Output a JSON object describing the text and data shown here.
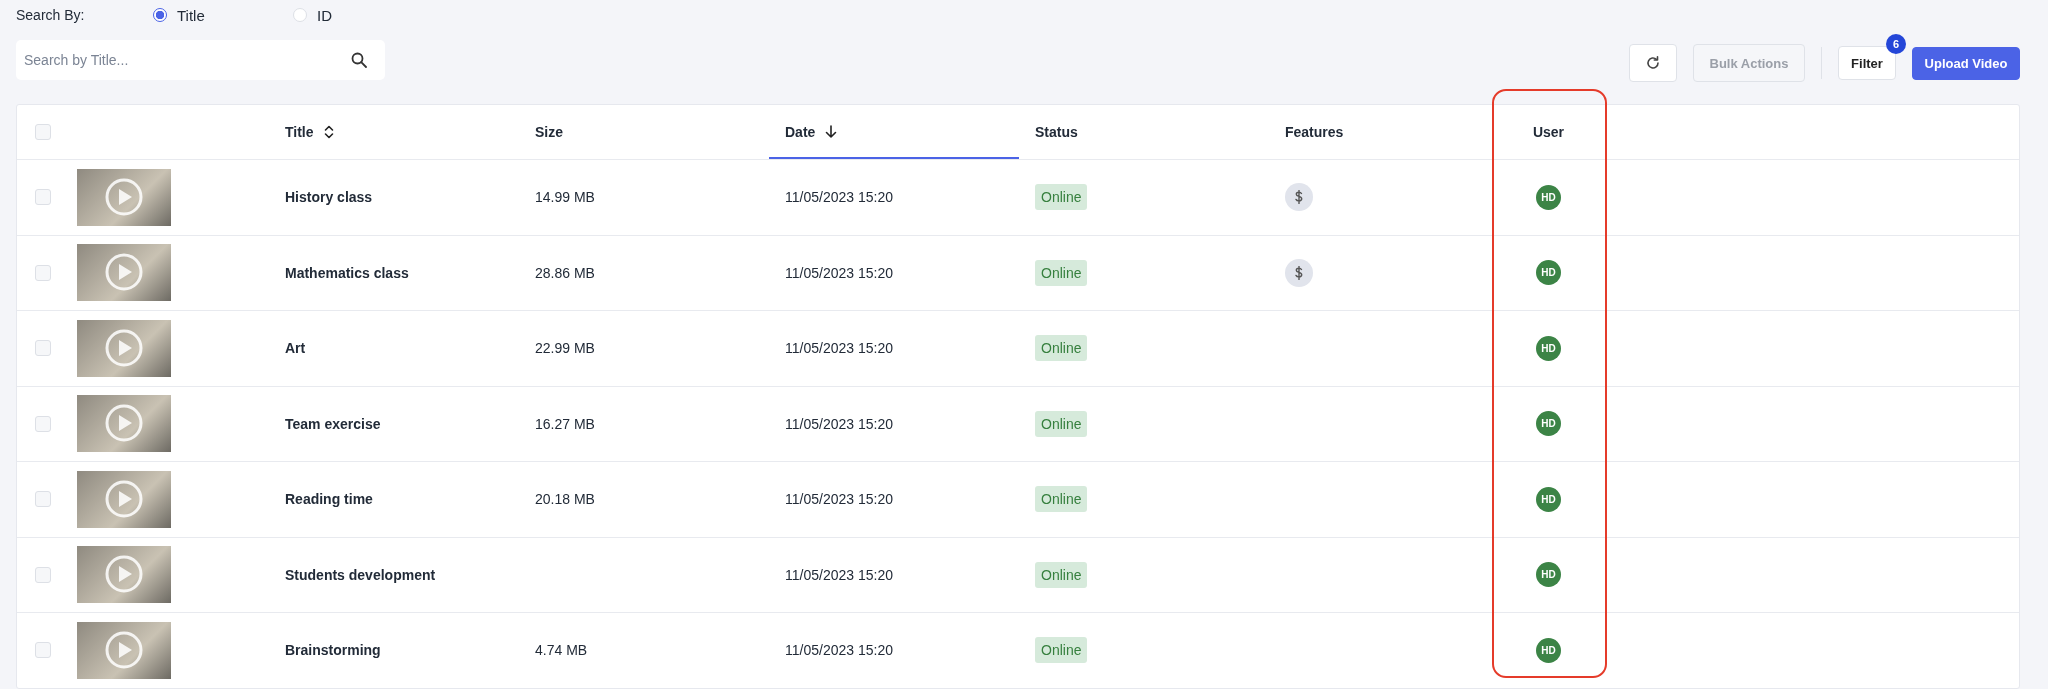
{
  "search_by": {
    "label": "Search By:",
    "options": [
      {
        "label": "Title",
        "selected": true
      },
      {
        "label": "ID",
        "selected": false
      }
    ]
  },
  "search": {
    "placeholder": "Search by Title..."
  },
  "toolbar": {
    "bulk_actions": {
      "label": "Bulk Actions",
      "disabled": true
    },
    "filter": {
      "label": "Filter",
      "badge": "6"
    },
    "upload": {
      "label": "Upload Video"
    }
  },
  "table": {
    "select_all": {
      "checked": false
    },
    "columns": [
      {
        "label": "Title",
        "sortable": true
      },
      {
        "label": "Size"
      },
      {
        "label": "Date",
        "sorted_descending": true
      },
      {
        "label": "Status"
      },
      {
        "label": "Features"
      },
      {
        "label": "User",
        "highlighted": true
      }
    ],
    "rows": [
      {
        "checked": false,
        "title": "History class",
        "size": "14.99 MB",
        "date": "11/05/2023 15:20",
        "status": "Online",
        "features": [
          {
            "kind": "dollar"
          }
        ],
        "user": "HD"
      },
      {
        "checked": false,
        "title": "Mathematics class",
        "size": "28.86 MB",
        "date": "11/05/2023 15:20",
        "status": "Online",
        "features": [
          {
            "kind": "dollar"
          }
        ],
        "user": "HD"
      },
      {
        "checked": false,
        "title": "Art",
        "size": "22.99 MB",
        "date": "11/05/2023 15:20",
        "status": "Online",
        "features": [],
        "user": "HD"
      },
      {
        "checked": false,
        "title": "Team exercise",
        "size": "16.27 MB",
        "date": "11/05/2023 15:20",
        "status": "Online",
        "features": [],
        "user": "HD"
      },
      {
        "checked": false,
        "title": "Reading time",
        "size": "20.18 MB",
        "date": "11/05/2023 15:20",
        "status": "Online",
        "features": [],
        "user": "HD"
      },
      {
        "checked": false,
        "title": "Students development",
        "date": "11/05/2023 15:20",
        "status": "Online",
        "features": [],
        "user": "HD"
      },
      {
        "checked": false,
        "title": "Brainstorming",
        "size": "4.74 MB",
        "date": "11/05/2023 15:20",
        "status": "Online",
        "features": [],
        "user": "HD"
      }
    ]
  },
  "annotation": {
    "kind": "outline"
  }
}
